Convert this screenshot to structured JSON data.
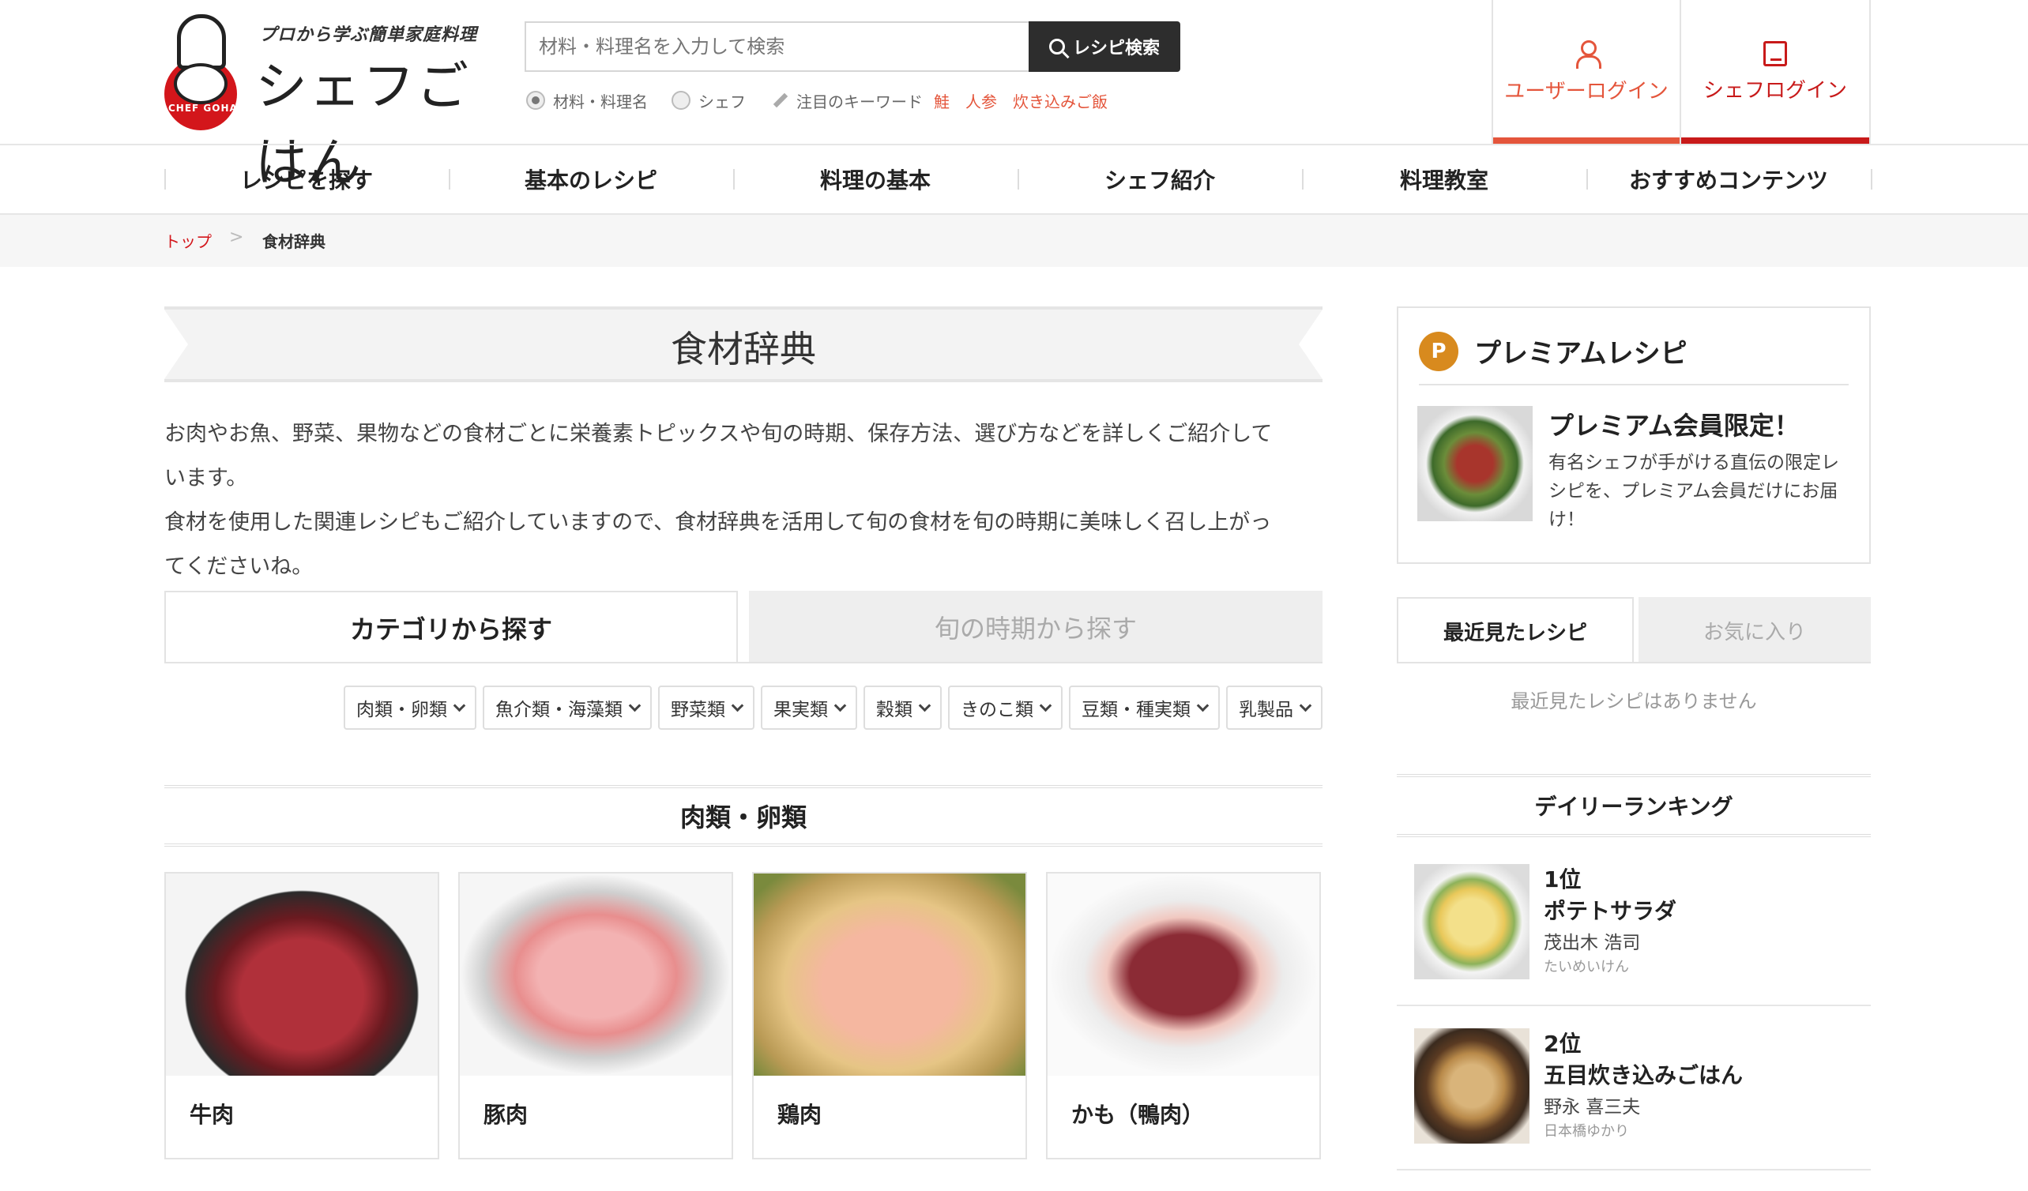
{
  "header": {
    "tagline": "プロから学ぶ簡単家庭料理",
    "site_name": "シェフごはん",
    "logo_text": "CHEF GOHAN",
    "search_placeholder": "材料・料理名を入力して検索",
    "search_button": "レシピ検索",
    "search_modes": [
      "材料・料理名",
      "シェフ"
    ],
    "keyword_label": "注目のキーワード",
    "keywords": [
      "鮭",
      "人参",
      "炊き込みご飯"
    ],
    "user_login": "ユーザーログイン",
    "chef_login": "シェフログイン",
    "accent_color": "#e4553b",
    "brand_red": "#d3161b"
  },
  "nav": {
    "items": [
      "レシピを探す",
      "基本のレシピ",
      "料理の基本",
      "シェフ紹介",
      "料理教室",
      "おすすめコンテンツ"
    ]
  },
  "breadcrumb": {
    "top": "トップ",
    "separator": ">",
    "current": "食材辞典"
  },
  "main": {
    "title": "食材辞典",
    "intro": [
      "お肉やお魚、野菜、果物などの食材ごとに栄養素トピックスや旬の時期、保存方法、選び方などを詳しくご紹介して",
      "います。",
      "食材を使用した関連レシピもご紹介していますので、食材辞典を活用して旬の食材を旬の時期に美味しく召し上がっ",
      "てくださいね。"
    ],
    "tabs": [
      "カテゴリから探す",
      "旬の時期から探す"
    ],
    "categories": [
      "肉類・卵類",
      "魚介類・海藻類",
      "野菜類",
      "果実類",
      "穀類",
      "きのこ類",
      "豆類・種実類",
      "乳製品"
    ],
    "section_title": "肉類・卵類",
    "items": [
      {
        "name": "牛肉",
        "image": "beef-image"
      },
      {
        "name": "豚肉",
        "image": "pork-image"
      },
      {
        "name": "鶏肉",
        "image": "chicken-image"
      },
      {
        "name": "かも（鴨肉）",
        "image": "duck-image"
      }
    ]
  },
  "sidebar": {
    "premium": {
      "badge": "P",
      "heading": "プレミアムレシピ",
      "title": "プレミアム会員限定！",
      "description": "有名シェフが手がける直伝の限定レシピを、プレミアム会員だけにお届け！"
    },
    "tabs": [
      "最近見たレシピ",
      "お気に入り"
    ],
    "recent_empty": "最近見たレシピはありません",
    "ranking_title": "デイリーランキング",
    "ranking": [
      {
        "rank": "1位",
        "title": "ポテトサラダ",
        "chef": "茂出木 浩司",
        "shop": "たいめいけん"
      },
      {
        "rank": "2位",
        "title": "五目炊き込みごはん",
        "chef": "野永 喜三夫",
        "shop": "日本橋ゆかり"
      }
    ]
  }
}
